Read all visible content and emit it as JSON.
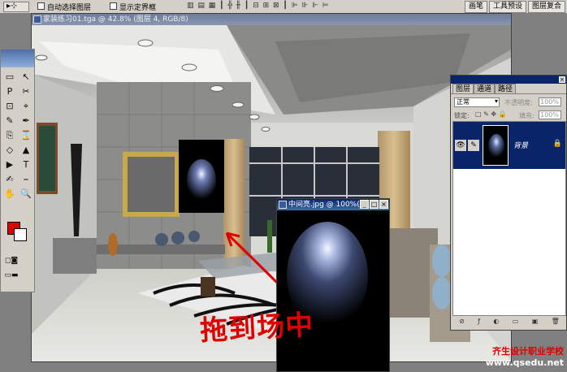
{
  "options_bar": {
    "auto_select_label": "自动选择图层",
    "show_bounds_label": "显示定界框",
    "palette_tabs": [
      "画笔",
      "工具预设",
      "图层复合"
    ]
  },
  "document": {
    "title": "家装练习01.tga @ 42.8% (图层 4, RGB/8)"
  },
  "toolbox": {
    "foreground_color": "#e00000",
    "background_color": "#ffffff",
    "tools": [
      "▭",
      "↖",
      "P",
      "✂",
      "⊡",
      "⌖",
      "✎",
      "✒",
      "⎘",
      "⌛",
      "◇",
      "▲",
      "▶",
      "T",
      "✍",
      "⎯",
      "✋",
      "🔍"
    ]
  },
  "layers_panel": {
    "tabs": [
      "图层",
      "通道",
      "路径"
    ],
    "blend_mode": "正常",
    "opacity_label": "不透明度:",
    "opacity_value": "100%",
    "lock_label": "锁定:",
    "fill_label": "填充:",
    "fill_value": "100%",
    "layer_name": "背景",
    "footer_icons": [
      "⊘",
      "ƒ",
      "◐",
      "▭",
      "▣",
      "🗑"
    ]
  },
  "mid_window": {
    "title": "中间亮.jpg @ 100%(..."
  },
  "annotation": {
    "handwriting": "拖到场中",
    "school_name": "齐生设计职业学校",
    "school_url": "www.qsedu.net"
  },
  "colors": {
    "annotation_red": "#e00000",
    "selection_blue": "#0a246a"
  }
}
